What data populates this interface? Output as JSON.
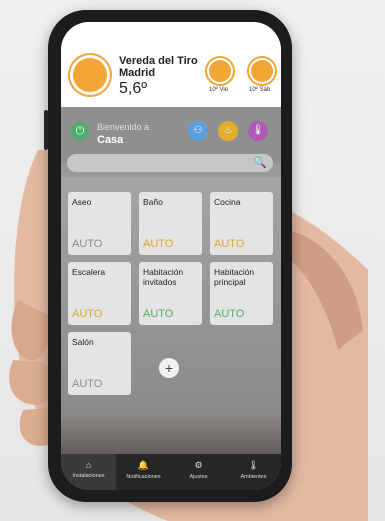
{
  "weather": {
    "location_line1": "Vereda del Tiro",
    "location_line2": "Madrid",
    "temperature": "5,6º",
    "forecast": [
      {
        "label": "10º Vie"
      },
      {
        "label": "10º Sáb"
      }
    ]
  },
  "home": {
    "welcome": "Bienvenido a",
    "name": "Casa"
  },
  "rooms": [
    {
      "name": "Aseo",
      "mode": "AUTO"
    },
    {
      "name": "Baño",
      "mode": "AUTO"
    },
    {
      "name": "Cocina",
      "mode": "AUTO"
    },
    {
      "name": "Escalera",
      "mode": "AUTO"
    },
    {
      "name": "Habitación invitados",
      "mode": "AUTO"
    },
    {
      "name": "Habitación principal",
      "mode": "AUTO"
    },
    {
      "name": "Salón",
      "mode": "AUTO"
    }
  ],
  "nav": [
    {
      "label": "Instalaciones"
    },
    {
      "label": "Notificaciones"
    },
    {
      "label": "Ajustes"
    },
    {
      "label": "Ambientes"
    }
  ]
}
